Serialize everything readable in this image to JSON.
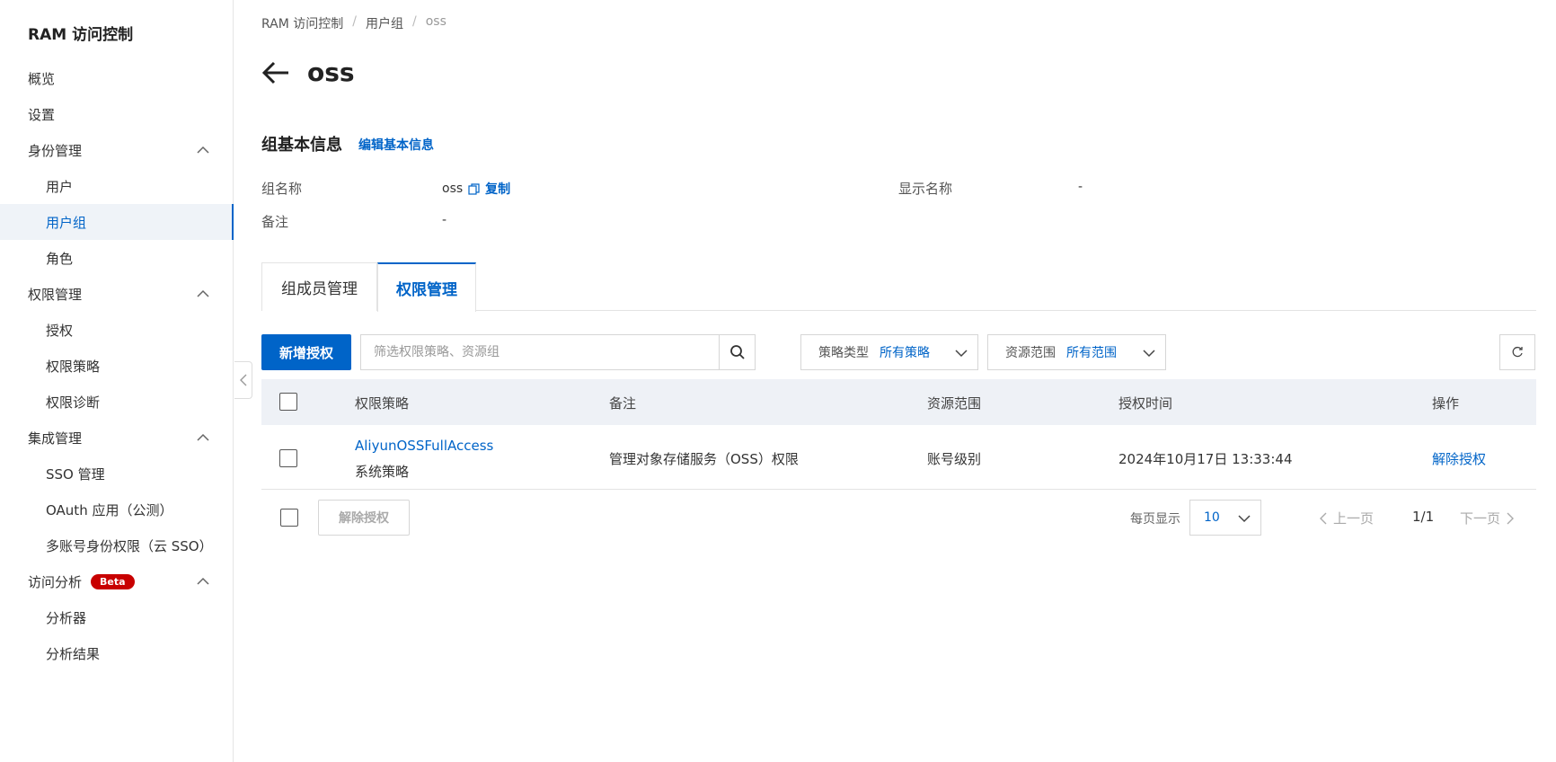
{
  "sidebar": {
    "title": "RAM 访问控制",
    "items": [
      {
        "label": "概览"
      },
      {
        "label": "设置"
      },
      {
        "label": "身份管理"
      },
      {
        "label": "用户"
      },
      {
        "label": "用户组"
      },
      {
        "label": "角色"
      },
      {
        "label": "权限管理"
      },
      {
        "label": "授权"
      },
      {
        "label": "权限策略"
      },
      {
        "label": "权限诊断"
      },
      {
        "label": "集成管理"
      },
      {
        "label": "SSO 管理"
      },
      {
        "label": "OAuth 应用（公测）"
      },
      {
        "label": "多账号身份权限（云 SSO）"
      },
      {
        "label": "访问分析",
        "badge": "Beta"
      },
      {
        "label": "分析器"
      },
      {
        "label": "分析结果"
      }
    ]
  },
  "breadcrumb": [
    "RAM 访问控制",
    "用户组",
    "oss"
  ],
  "page": {
    "title": "oss"
  },
  "basic_info": {
    "title": "组基本信息",
    "edit_link": "编辑基本信息",
    "group_name_label": "组名称",
    "group_name_value": "oss",
    "copy_label": "复制",
    "display_name_label": "显示名称",
    "display_name_value": "-",
    "remark_label": "备注",
    "remark_value": "-"
  },
  "tabs": [
    {
      "label": "组成员管理",
      "active": false
    },
    {
      "label": "权限管理",
      "active": true
    }
  ],
  "toolbar": {
    "add_button": "新增授权",
    "search_placeholder": "筛选权限策略、资源组",
    "policy_type_label": "策略类型",
    "policy_type_value": "所有策略",
    "scope_label": "资源范围",
    "scope_value": "所有范围"
  },
  "table": {
    "headers": [
      "权限策略",
      "备注",
      "资源范围",
      "授权时间",
      "操作"
    ],
    "rows": [
      {
        "policy_name": "AliyunOSSFullAccess",
        "policy_type": "系统策略",
        "remark": "管理对象存储服务（OSS）权限",
        "scope": "账号级别",
        "time": "2024年10月17日 13:33:44",
        "action": "解除授权"
      }
    ]
  },
  "footer": {
    "bulk_revoke": "解除授权",
    "per_page_label": "每页显示",
    "per_page_value": "10",
    "prev": "上一页",
    "page_info": "1/1",
    "next": "下一页"
  },
  "colors": {
    "accent": "#0064c8",
    "badge": "#c80000"
  }
}
